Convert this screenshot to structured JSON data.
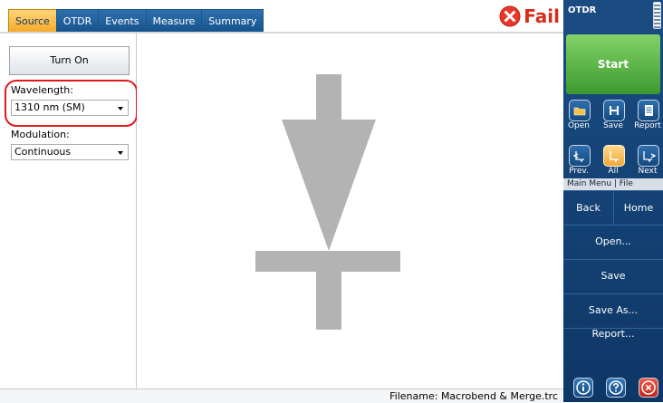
{
  "tabs": [
    {
      "label": "Source",
      "active": true
    },
    {
      "label": "OTDR",
      "active": false
    },
    {
      "label": "Events",
      "active": false
    },
    {
      "label": "Measure",
      "active": false
    },
    {
      "label": "Summary",
      "active": false
    }
  ],
  "status": {
    "text": "Fail",
    "icon": "fail-x-icon",
    "color": "#d62b1a"
  },
  "source_panel": {
    "turn_on_label": "Turn On",
    "wavelength_label": "Wavelength:",
    "wavelength_value": "1310 nm (SM)",
    "modulation_label": "Modulation:",
    "modulation_value": "Continuous"
  },
  "footer": {
    "filename_text": "Filename: Macrobend & Merge.trc"
  },
  "sidebar": {
    "title": "OTDR",
    "start_label": "Start",
    "icons": [
      {
        "label": "Open",
        "icon": "folder-icon"
      },
      {
        "label": "Save",
        "icon": "floppy-disk-icon"
      },
      {
        "label": "Report",
        "icon": "report-icon"
      },
      {
        "label": "Prev.",
        "icon": "prev-trace-icon"
      },
      {
        "label": "All",
        "icon": "all-traces-icon"
      },
      {
        "label": "Next",
        "icon": "next-trace-icon"
      }
    ],
    "menu_breadcrumb": "Main Menu | File",
    "back_label": "Back",
    "home_label": "Home",
    "menu_items": [
      "Open...",
      "Save",
      "Save As...",
      "Report..."
    ],
    "bottom_icons": [
      "info-icon",
      "help-icon",
      "close-icon"
    ]
  },
  "colors": {
    "tab_blue": "#1d5f9e",
    "tab_active": "#f5a623",
    "start_green": "#4aa83a",
    "sidebar_blue": "#0e3766",
    "fail_red": "#d62b1a",
    "laser_symbol_gray": "#b3b3b3",
    "highlight_red": "#e0191b"
  }
}
